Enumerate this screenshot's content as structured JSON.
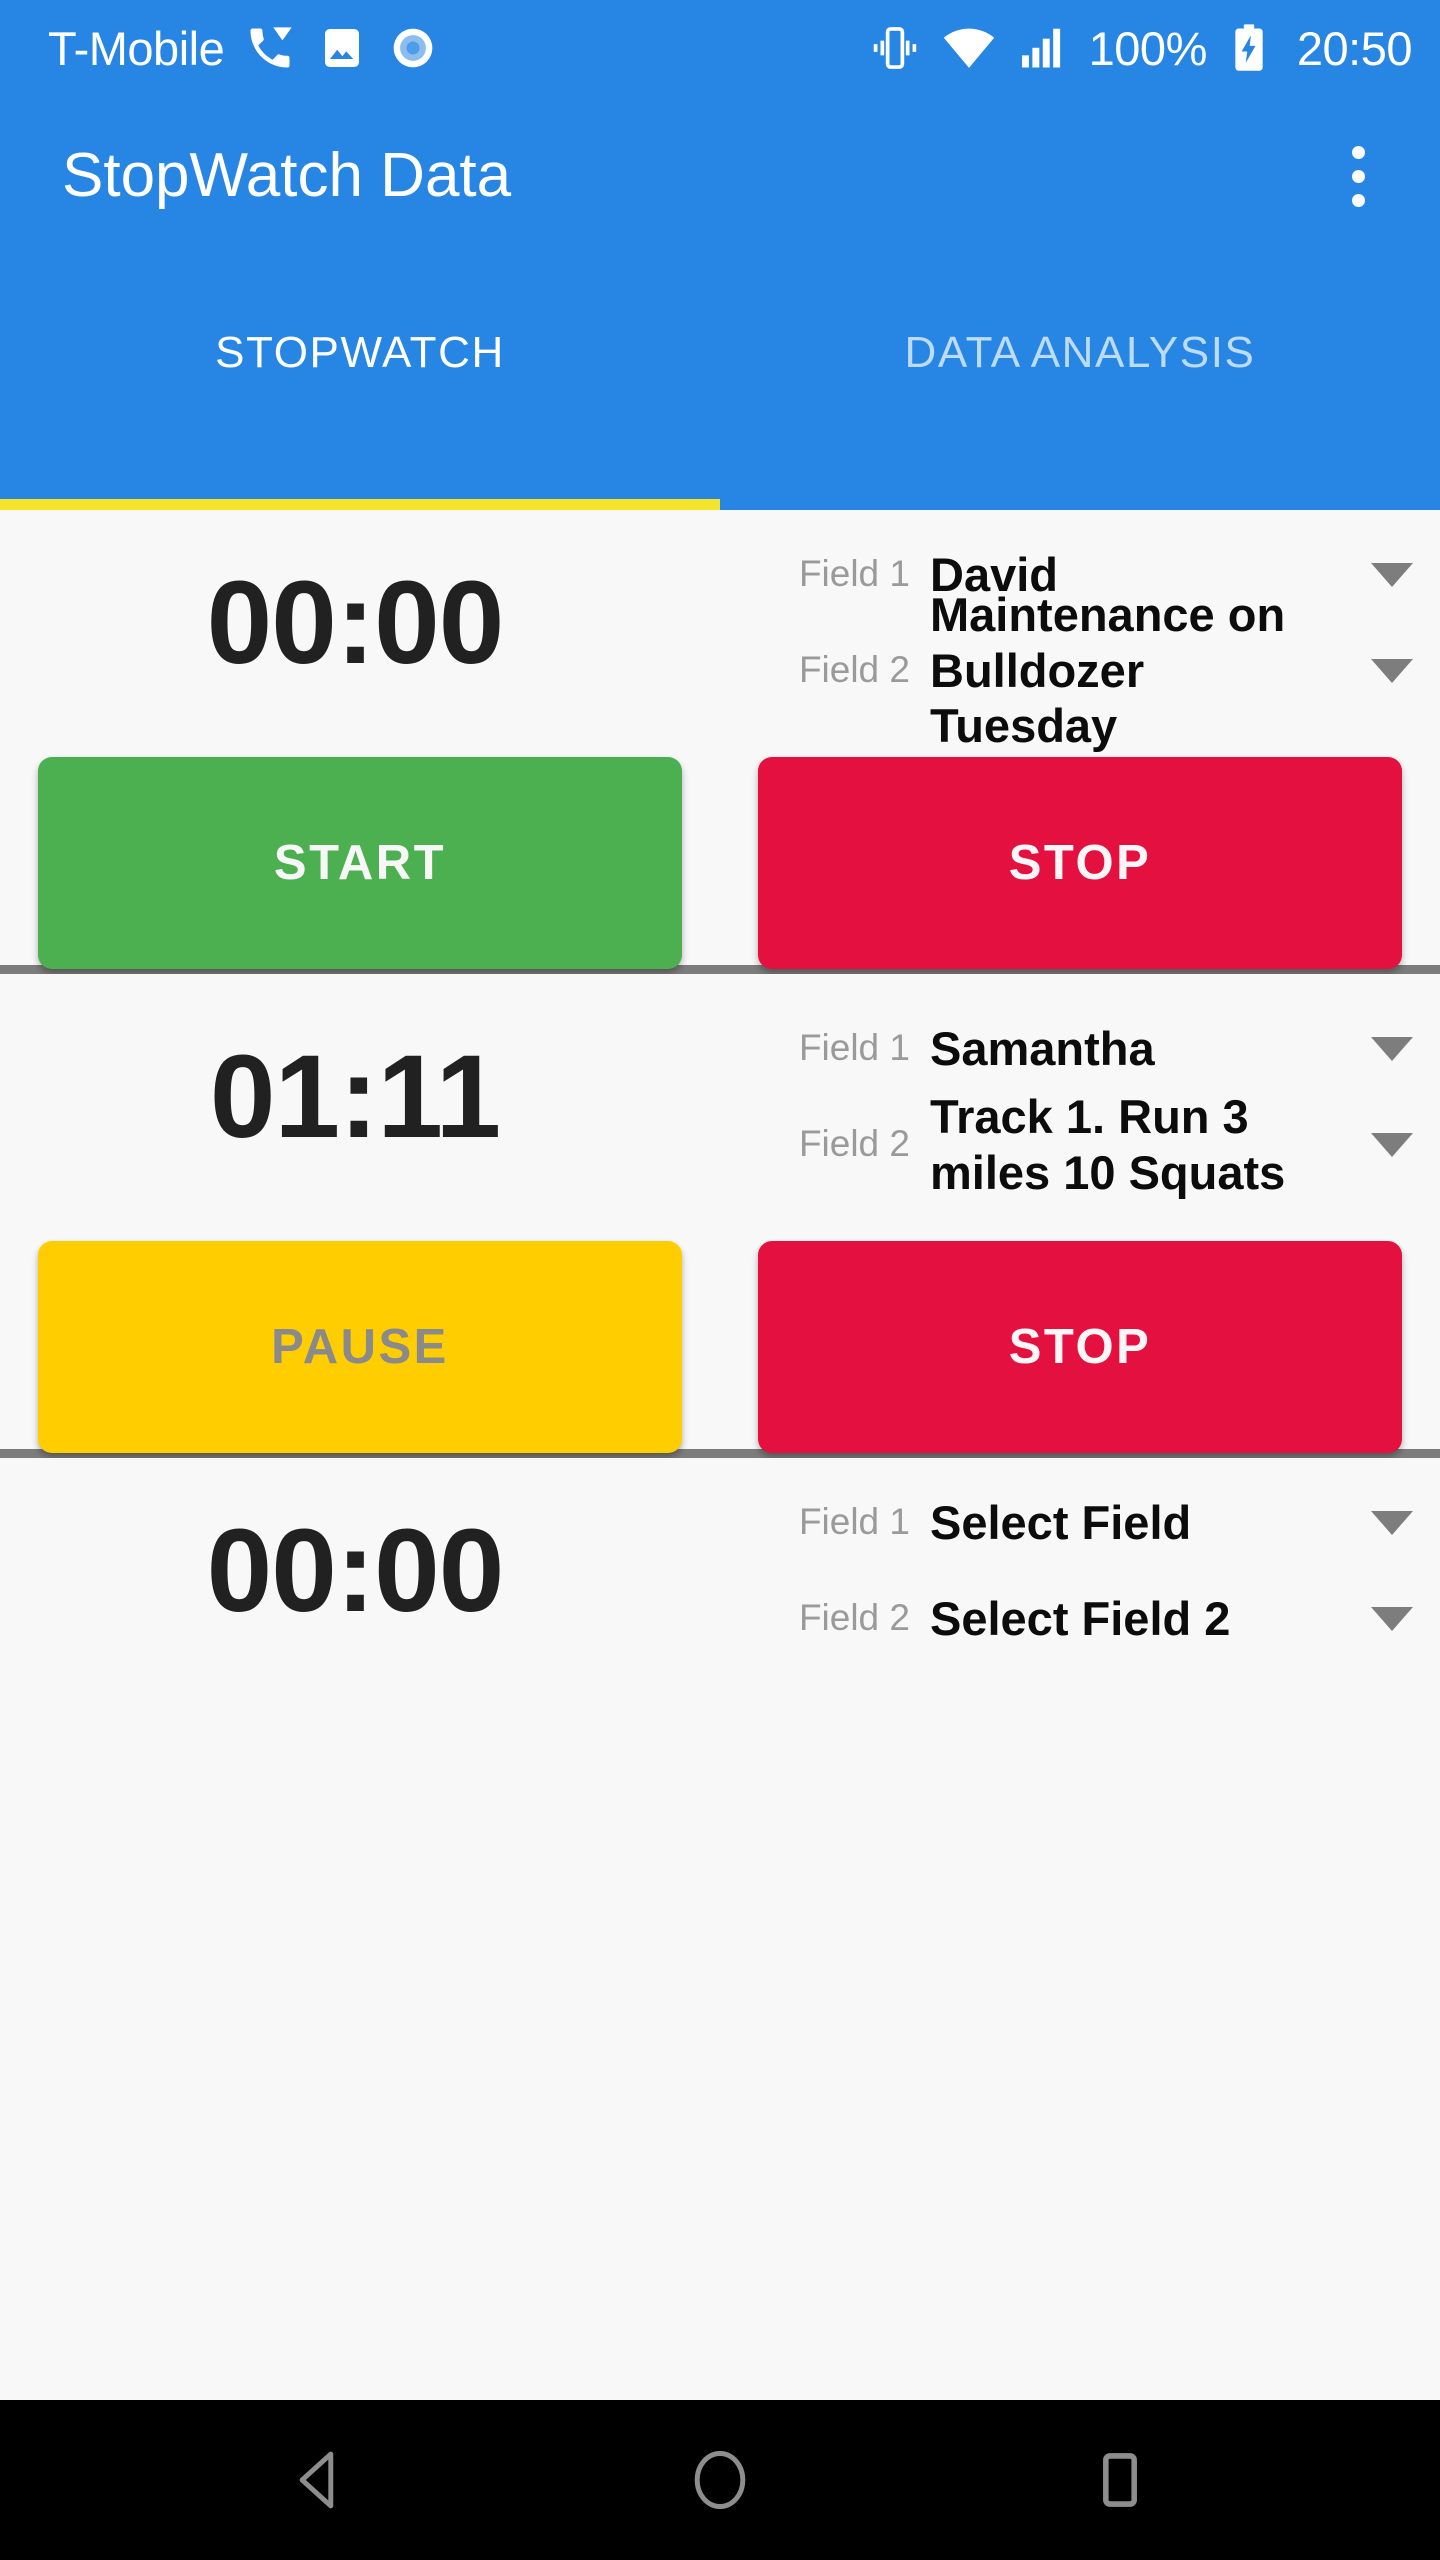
{
  "status_bar": {
    "carrier": "T-Mobile",
    "battery_percent": "100%",
    "clock": "20:50",
    "icons": [
      "missed-call-icon",
      "screenshot-icon",
      "record-icon",
      "vibrate-icon",
      "wifi-icon",
      "cellular-signal-icon",
      "battery-charging-icon"
    ]
  },
  "app_bar": {
    "title": "StopWatch Data",
    "overflow_icon": "more-vert-icon"
  },
  "tabs": [
    {
      "label": "STOPWATCH",
      "active": true
    },
    {
      "label": "DATA ANALYSIS",
      "active": false
    }
  ],
  "colors": {
    "primary_blue": "#2785e4",
    "tab_indicator_yellow": "#f5e52a",
    "start_green": "#4cb050",
    "stop_red": "#e4103f",
    "pause_yellow": "#ffcd00",
    "divider_gray": "#7c7c7c",
    "inactive_tab": "#bcdbf7"
  },
  "field_labels": {
    "field1": "Field 1",
    "field2": "Field 2"
  },
  "stopwatches": [
    {
      "time": "00:00",
      "field1_label": "Field 1",
      "field1_value": "David",
      "field2_label": "Field 2",
      "field2_value": "Maintenance on Bulldozer Tuesday",
      "primary_button": "START",
      "primary_state": "start",
      "secondary_button": "STOP"
    },
    {
      "time": "01:11",
      "field1_label": "Field 1",
      "field1_value": "Samantha",
      "field2_label": "Field 2",
      "field2_value": "Track 1. Run 3 miles 10 Squats",
      "primary_button": "PAUSE",
      "primary_state": "pause",
      "secondary_button": "STOP"
    },
    {
      "time": "00:00",
      "field1_label": "Field 1",
      "field1_value": "Select Field",
      "field2_label": "Field 2",
      "field2_value": "Select Field 2",
      "primary_button": "",
      "primary_state": "none",
      "secondary_button": ""
    }
  ],
  "nav_bar": {
    "back": "back-triangle-icon",
    "home": "home-circle-icon",
    "recents": "recents-square-icon"
  }
}
